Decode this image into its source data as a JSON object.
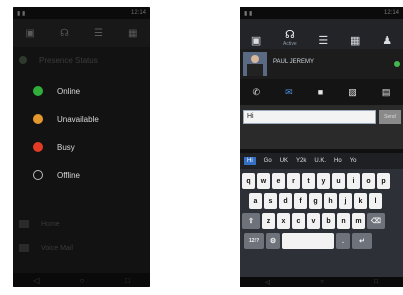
{
  "left": {
    "status_text": "12:14",
    "toolbar_icons": [
      "briefcase-icon",
      "headset-icon",
      "list-icon",
      "grid-icon"
    ],
    "profile_status_label": "Presence Status",
    "menu": [
      {
        "label": "Online",
        "color": "#2fae3b"
      },
      {
        "label": "Unavailable",
        "color": "#e3972c"
      },
      {
        "label": "Busy",
        "color": "#e23b26"
      },
      {
        "label": "Offline",
        "color": ""
      }
    ],
    "lower_items": [
      "Home",
      "Voice Mail"
    ]
  },
  "right": {
    "status_text": "12:14",
    "tabs": [
      {
        "label": "",
        "icon": "phone-book-icon"
      },
      {
        "label": "Active",
        "icon": "headset-icon"
      },
      {
        "label": "",
        "icon": "list-icon"
      },
      {
        "label": "",
        "icon": "grid-icon"
      },
      {
        "label": "",
        "icon": "person-icon"
      }
    ],
    "contact_name": "PAUL JEREMY",
    "actions": [
      "phone-icon",
      "chat-icon",
      "video-icon",
      "image-icon",
      "card-icon"
    ],
    "message_value": "Hi",
    "send_label": "Send",
    "suggestions": [
      "Hi",
      "Go",
      "UK",
      "Y2k",
      "U.K.",
      "Ho",
      "Yo"
    ],
    "keys_row1": [
      "q",
      "w",
      "e",
      "r",
      "t",
      "y",
      "u",
      "i",
      "o",
      "p"
    ],
    "keys_row2": [
      "a",
      "s",
      "d",
      "f",
      "g",
      "h",
      "j",
      "k",
      "l"
    ],
    "keys_row3": [
      "z",
      "x",
      "c",
      "v",
      "b",
      "n",
      "m"
    ],
    "symbol_key": "12!?",
    "enter_symbol": "↵"
  }
}
